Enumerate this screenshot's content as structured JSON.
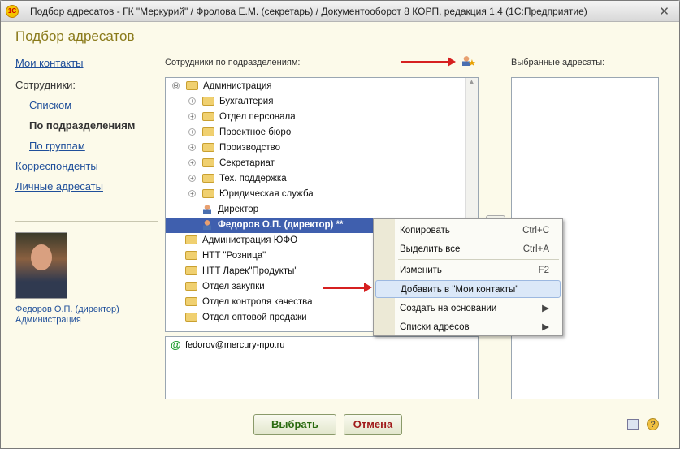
{
  "window": {
    "title": "Подбор адресатов - ГК \"Меркурий\" / Фролова Е.М. (секретарь) / Документооборот 8 КОРП, редакция 1.4  (1С:Предприятие)",
    "close": "✕"
  },
  "header": {
    "title": "Подбор адресатов"
  },
  "nav": {
    "my_contacts": "Мои контакты",
    "employees": "Сотрудники:",
    "list": "Списком",
    "by_dept": "По подразделениям",
    "by_groups": "По группам",
    "correspondents": "Корреспонденты",
    "personal": "Личные адресаты"
  },
  "person": {
    "name": "Федоров О.П. (директор)",
    "dept": "Администрация"
  },
  "tree": {
    "label": "Сотрудники по подразделениям:",
    "rows": [
      {
        "text": "Администрация",
        "level": 0,
        "type": "folder",
        "expand": "⊖"
      },
      {
        "text": "Бухгалтерия",
        "level": 1,
        "type": "folder",
        "expand": "+"
      },
      {
        "text": "Отдел персонала",
        "level": 1,
        "type": "folder",
        "expand": "+"
      },
      {
        "text": "Проектное бюро",
        "level": 1,
        "type": "folder",
        "expand": "+"
      },
      {
        "text": "Производство",
        "level": 1,
        "type": "folder",
        "expand": "+"
      },
      {
        "text": "Секретариат",
        "level": 1,
        "type": "folder",
        "expand": "+"
      },
      {
        "text": "Тех. поддержка",
        "level": 1,
        "type": "folder",
        "expand": "+"
      },
      {
        "text": "Юридическая служба",
        "level": 1,
        "type": "folder",
        "expand": "+"
      },
      {
        "text": "Директор",
        "level": 1,
        "type": "person",
        "expand": ""
      },
      {
        "text": "Федоров О.П. (директор) **",
        "level": 1,
        "type": "person",
        "expand": "",
        "selected": true
      },
      {
        "text": "Администрация ЮФО",
        "level": 0,
        "type": "folder",
        "expand": ""
      },
      {
        "text": "НТТ \"Розница\"",
        "level": 0,
        "type": "folder",
        "expand": ""
      },
      {
        "text": "НТТ Ларек\"Продукты\"",
        "level": 0,
        "type": "folder",
        "expand": ""
      },
      {
        "text": "Отдел закупки",
        "level": 0,
        "type": "folder",
        "expand": ""
      },
      {
        "text": "Отдел контроля качества",
        "level": 0,
        "type": "folder",
        "expand": ""
      },
      {
        "text": "Отдел оптовой продажи",
        "level": 0,
        "type": "folder",
        "expand": ""
      }
    ]
  },
  "email": "fedorov@mercury-npo.ru",
  "selected": {
    "label": "Выбранные адресаты:"
  },
  "menu": [
    {
      "label": "Копировать",
      "shortcut": "Ctrl+C"
    },
    {
      "label": "Выделить все",
      "shortcut": "Ctrl+A"
    },
    {
      "label": "Изменить",
      "shortcut": "F2"
    },
    {
      "label": "Добавить в \"Мои контакты\"",
      "shortcut": ""
    },
    {
      "label": "Создать на основании",
      "shortcut": "▶"
    },
    {
      "label": "Списки адресов",
      "shortcut": "▶"
    }
  ],
  "buttons": {
    "ok": "Выбрать",
    "cancel": "Отмена",
    "help": "?"
  }
}
